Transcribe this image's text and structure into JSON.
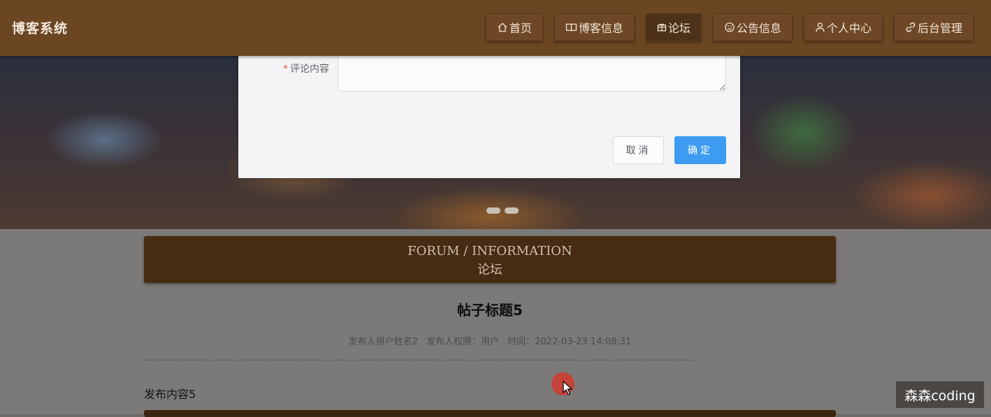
{
  "header": {
    "brand": "博客系统",
    "nav": [
      {
        "icon": "home-icon",
        "label": "首页"
      },
      {
        "icon": "book-icon",
        "label": "博客信息"
      },
      {
        "icon": "forum-icon",
        "label": "论坛",
        "active": true
      },
      {
        "icon": "smile-icon",
        "label": "公告信息"
      },
      {
        "icon": "user-icon",
        "label": "个人中心"
      },
      {
        "icon": "link-icon",
        "label": "后台管理"
      }
    ]
  },
  "carousel": {
    "dot_count": 2
  },
  "dialog": {
    "required_mark": "*",
    "comment_label": "评论内容",
    "comment_value": "",
    "cancel_label": "取消",
    "confirm_label": "确定",
    "confirm_color": "#3d9cf2"
  },
  "section": {
    "title_en": "FORUM / INFORMATION",
    "title_cn": "论坛"
  },
  "post": {
    "title": "帖子标题5",
    "meta": {
      "author": "发布人用户姓名2",
      "role": "发布人权限：用户",
      "time": "时间：2022-03-23 14:08:31"
    },
    "body": "发布内容5"
  },
  "watermark": "森森coding",
  "colors": {
    "nav_bg": "#6b4622",
    "section_bg": "#472b12",
    "primary": "#3d9cf2"
  }
}
